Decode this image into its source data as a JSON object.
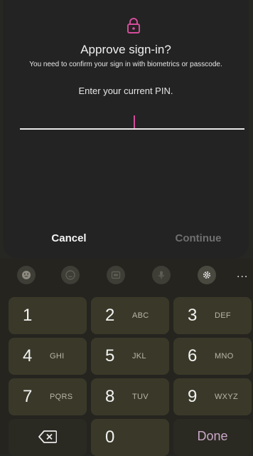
{
  "dialog": {
    "title": "Approve sign-in?",
    "subtitle": "You need to confirm your sign in with biometrics or passcode.",
    "prompt": "Enter your current PIN.",
    "pin_value": "",
    "cancel_label": "Cancel",
    "continue_label": "Continue"
  },
  "toolbar": {
    "icons": [
      "emoji-icon",
      "sticker-icon",
      "gif-icon",
      "microphone-icon",
      "settings-icon",
      "more-icon"
    ],
    "more_label": "..."
  },
  "keypad": {
    "keys": [
      {
        "num": "1",
        "letters": ""
      },
      {
        "num": "2",
        "letters": "ABC"
      },
      {
        "num": "3",
        "letters": "DEF"
      },
      {
        "num": "4",
        "letters": "GHI"
      },
      {
        "num": "5",
        "letters": "JKL"
      },
      {
        "num": "6",
        "letters": "MNO"
      },
      {
        "num": "7",
        "letters": "PQRS"
      },
      {
        "num": "8",
        "letters": "TUV"
      },
      {
        "num": "9",
        "letters": "WXYZ"
      },
      {
        "num": "0",
        "letters": ""
      }
    ],
    "done_label": "Done"
  },
  "colors": {
    "accent": "#d34c9a",
    "dialog_bg": "#232323",
    "keyboard_bg": "#25241f",
    "key_bg": "#3a3929"
  }
}
